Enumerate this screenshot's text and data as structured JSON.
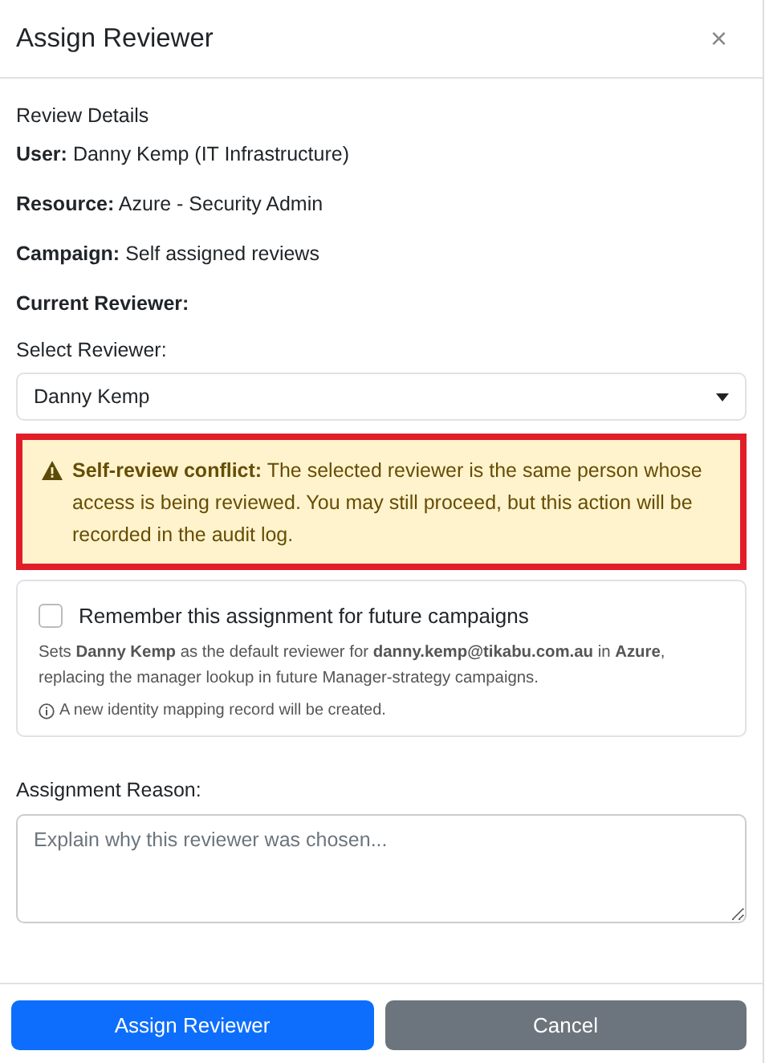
{
  "dialog": {
    "title": "Assign Reviewer",
    "close": "×"
  },
  "details": {
    "title": "Review Details",
    "lines": [
      {
        "kind": "field",
        "text": "**User:** Danny Kemp (IT Infrastructure)"
      },
      {
        "kind": "field",
        "text": "**Resource:** Azure - Security Admin"
      },
      {
        "kind": "field",
        "text": "**Campaign:** Self assigned reviews"
      },
      {
        "kind": "label",
        "text": "Current Reviewer:"
      }
    ]
  },
  "select": {
    "label": "Select Reviewer:",
    "value": "Danny Kemp"
  },
  "alert": {
    "text": "**Self-review conflict:** The selected reviewer is the same person whose access is being reviewed. You may still proceed, but this action will be recorded in the audit log.",
    "highlighted": true
  },
  "remember": {
    "label": "Remember this assignment for future campaigns",
    "checked": false,
    "hint": "Sets **Danny Kemp** as the default reviewer for **danny.kemp@tikabu.com.au** in **Azure**, replacing the manager lookup in future Manager-strategy campaigns.",
    "note": "A new identity mapping record will be created."
  },
  "reason": {
    "label": "Assignment Reason:",
    "placeholder": "Explain why this reviewer was chosen..."
  },
  "buttons": [
    {
      "label": "Assign Reviewer",
      "kind": "primary"
    },
    {
      "label": "Cancel",
      "kind": "secondary"
    }
  ]
}
